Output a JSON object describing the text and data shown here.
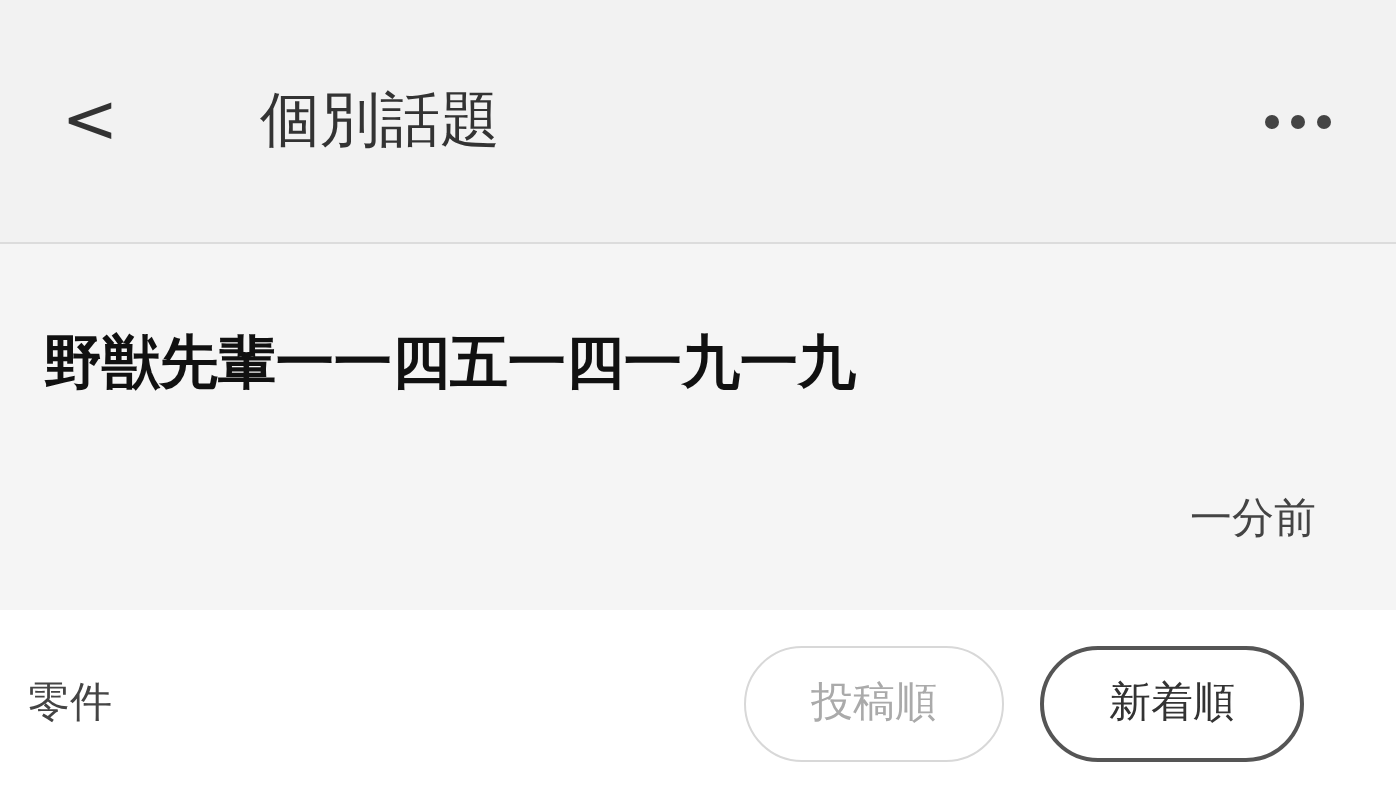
{
  "header": {
    "back": "<",
    "title": "個別話題"
  },
  "post": {
    "title": "野獣先輩一一四五一四一九一九",
    "time": "一分前"
  },
  "section": {
    "label": "零件",
    "sort_buttons": [
      {
        "label": "投稿順",
        "selected": false
      },
      {
        "label": "新着順",
        "selected": true
      }
    ]
  }
}
